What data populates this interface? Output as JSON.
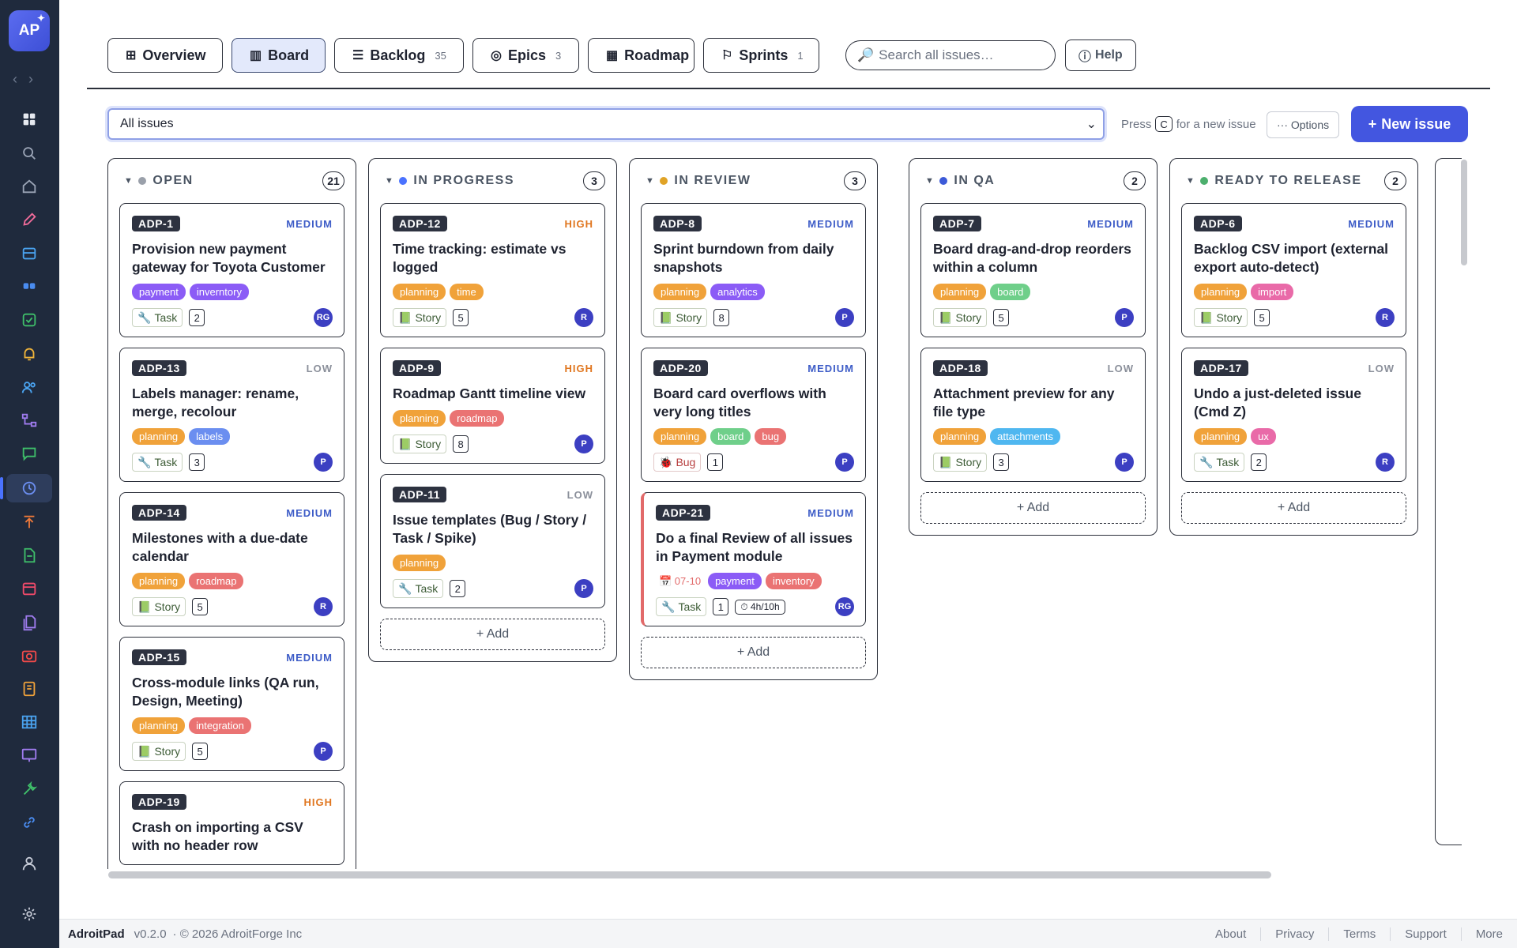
{
  "app": {
    "logo": "AP",
    "name": "AdroitPad",
    "version": "v0.2.0",
    "copyright": "· © 2026 AdroitForge Inc"
  },
  "tabs": [
    {
      "label": "Overview",
      "icon": "⊞",
      "count": ""
    },
    {
      "label": "Board",
      "icon": "▥",
      "count": ""
    },
    {
      "label": "Backlog",
      "icon": "☰",
      "count": "35"
    },
    {
      "label": "Epics",
      "icon": "◎",
      "count": "3"
    },
    {
      "label": "Roadmap",
      "icon": "▦",
      "count": ""
    },
    {
      "label": "Sprints",
      "icon": "⚐",
      "count": "1"
    }
  ],
  "search": {
    "placeholder": "Search all issues…",
    "icon": "🔎"
  },
  "help": {
    "label": "Help",
    "icon": "ⓘ"
  },
  "filter": {
    "value": "All issues"
  },
  "hint": {
    "press": "Press",
    "key": "C",
    "rest": "for a new issue"
  },
  "options": "··· Options",
  "new_issue": "New issue",
  "add_label": "+ Add",
  "columns": [
    {
      "name": "OPEN",
      "count": "21",
      "dot": "#9aa0aa",
      "cards": [
        {
          "key": "ADP-1",
          "priority": "MEDIUM",
          "title": "Provision new payment gateway for Toyota Customer",
          "labels": [
            [
              "payment",
              "#8b5cf6"
            ],
            [
              "inverntory",
              "#8b5cf6"
            ]
          ],
          "type": "Task",
          "type_icon": "🔧",
          "points": "2",
          "avatar": "RG"
        },
        {
          "key": "ADP-13",
          "priority": "LOW",
          "title": "Labels manager: rename, merge, recolour",
          "labels": [
            [
              "planning",
              "#f0a23a"
            ],
            [
              "labels",
              "#6b8ef0"
            ]
          ],
          "type": "Task",
          "type_icon": "🔧",
          "points": "3",
          "avatar": "P"
        },
        {
          "key": "ADP-14",
          "priority": "MEDIUM",
          "title": "Milestones with a due-date calendar",
          "labels": [
            [
              "planning",
              "#f0a23a"
            ],
            [
              "roadmap",
              "#ea7373"
            ]
          ],
          "type": "Story",
          "type_icon": "📗",
          "points": "5",
          "avatar": "R"
        },
        {
          "key": "ADP-15",
          "priority": "MEDIUM",
          "title": "Cross-module links (QA run, Design, Meeting)",
          "labels": [
            [
              "planning",
              "#f0a23a"
            ],
            [
              "integration",
              "#ea7373"
            ]
          ],
          "type": "Story",
          "type_icon": "📗",
          "points": "5",
          "avatar": "P"
        },
        {
          "key": "ADP-19",
          "priority": "HIGH",
          "title": "Crash on importing a CSV with no header row",
          "labels": [],
          "type": "",
          "type_icon": "",
          "points": "",
          "avatar": ""
        }
      ]
    },
    {
      "name": "IN PROGRESS",
      "count": "3",
      "dot": "#4a72ff",
      "cards": [
        {
          "key": "ADP-12",
          "priority": "HIGH",
          "title": "Time tracking: estimate vs logged",
          "labels": [
            [
              "planning",
              "#f0a23a"
            ],
            [
              "time",
              "#f0a23a"
            ]
          ],
          "type": "Story",
          "type_icon": "📗",
          "points": "5",
          "avatar": "R"
        },
        {
          "key": "ADP-9",
          "priority": "HIGH",
          "title": "Roadmap Gantt timeline view",
          "labels": [
            [
              "planning",
              "#f0a23a"
            ],
            [
              "roadmap",
              "#ea7373"
            ]
          ],
          "type": "Story",
          "type_icon": "📗",
          "points": "8",
          "avatar": "P"
        },
        {
          "key": "ADP-11",
          "priority": "LOW",
          "title": "Issue templates (Bug / Story / Task / Spike)",
          "labels": [
            [
              "planning",
              "#f0a23a"
            ]
          ],
          "type": "Task",
          "type_icon": "🔧",
          "points": "2",
          "avatar": "P"
        }
      ]
    },
    {
      "name": "IN REVIEW",
      "count": "3",
      "dot": "#e0a326",
      "cards": [
        {
          "key": "ADP-8",
          "priority": "MEDIUM",
          "title": "Sprint burndown from daily snapshots",
          "labels": [
            [
              "planning",
              "#f0a23a"
            ],
            [
              "analytics",
              "#8b5cf6"
            ]
          ],
          "type": "Story",
          "type_icon": "📗",
          "points": "8",
          "avatar": "P"
        },
        {
          "key": "ADP-20",
          "priority": "MEDIUM",
          "title": "Board card overflows with very long titles",
          "labels": [
            [
              "planning",
              "#f0a23a"
            ],
            [
              "board",
              "#6fcf8a"
            ],
            [
              "bug",
              "#ea7373"
            ]
          ],
          "type": "Bug",
          "type_icon": "🐞",
          "points": "1",
          "avatar": "P"
        },
        {
          "key": "ADP-21",
          "priority": "MEDIUM",
          "title": "Do a final Review of all issues in Payment module",
          "due": "📅 07-10",
          "labels": [
            [
              "payment",
              "#8b5cf6"
            ],
            [
              "inventory",
              "#ea7373"
            ]
          ],
          "type": "Task",
          "type_icon": "🔧",
          "points": "1",
          "estimate": "⏱ 4h/10h",
          "avatar": "RG",
          "flag": true
        }
      ]
    },
    {
      "name": "IN QA",
      "count": "2",
      "dot": "#3c5ad8",
      "cards": [
        {
          "key": "ADP-7",
          "priority": "MEDIUM",
          "title": "Board drag-and-drop reorders within a column",
          "labels": [
            [
              "planning",
              "#f0a23a"
            ],
            [
              "board",
              "#6fcf8a"
            ]
          ],
          "type": "Story",
          "type_icon": "📗",
          "points": "5",
          "avatar": "P"
        },
        {
          "key": "ADP-18",
          "priority": "LOW",
          "title": "Attachment preview for any file type",
          "labels": [
            [
              "planning",
              "#f0a23a"
            ],
            [
              "attachments",
              "#4fb7f0"
            ]
          ],
          "type": "Story",
          "type_icon": "📗",
          "points": "3",
          "avatar": "P"
        }
      ]
    },
    {
      "name": "READY TO RELEASE",
      "count": "2",
      "dot": "#4caf6d",
      "cards": [
        {
          "key": "ADP-6",
          "priority": "MEDIUM",
          "title": "Backlog CSV import (external export auto-detect)",
          "labels": [
            [
              "planning",
              "#f0a23a"
            ],
            [
              "import",
              "#e96aa8"
            ]
          ],
          "type": "Story",
          "type_icon": "📗",
          "points": "5",
          "avatar": "R"
        },
        {
          "key": "ADP-17",
          "priority": "LOW",
          "title": "Undo a just-deleted issue (Cmd Z)",
          "labels": [
            [
              "planning",
              "#f0a23a"
            ],
            [
              "ux",
              "#e96aa8"
            ]
          ],
          "type": "Task",
          "type_icon": "🔧",
          "points": "2",
          "avatar": "R"
        }
      ]
    }
  ],
  "footer_links": [
    "About",
    "Privacy",
    "Terms",
    "Support",
    "More"
  ]
}
